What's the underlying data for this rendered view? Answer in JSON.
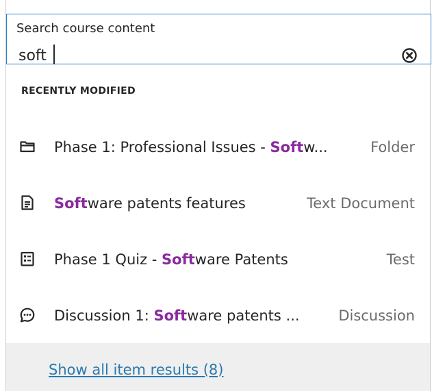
{
  "search": {
    "legend": "Search course content",
    "value": "soft"
  },
  "section": {
    "heading": "RECENTLY MODIFIED"
  },
  "results": [
    {
      "icon": "folder-icon",
      "pre": "Phase 1: Professional Issues - ",
      "match": "Soft",
      "post": "w...",
      "type": "Folder"
    },
    {
      "icon": "document-icon",
      "pre": "",
      "match": "Soft",
      "post": "ware patents features",
      "type": "Text Document"
    },
    {
      "icon": "test-icon",
      "pre": "Phase 1 Quiz - ",
      "match": "Soft",
      "post": "ware Patents",
      "type": "Test"
    },
    {
      "icon": "discussion-icon",
      "pre": "Discussion 1: ",
      "match": "Soft",
      "post": "ware patents ...",
      "type": "Discussion"
    }
  ],
  "footer": {
    "show_all": "Show all item results (8)"
  },
  "colors": {
    "accent_border": "#2c7ec9",
    "highlight": "#8a2a9e",
    "link": "#2a7aad"
  }
}
